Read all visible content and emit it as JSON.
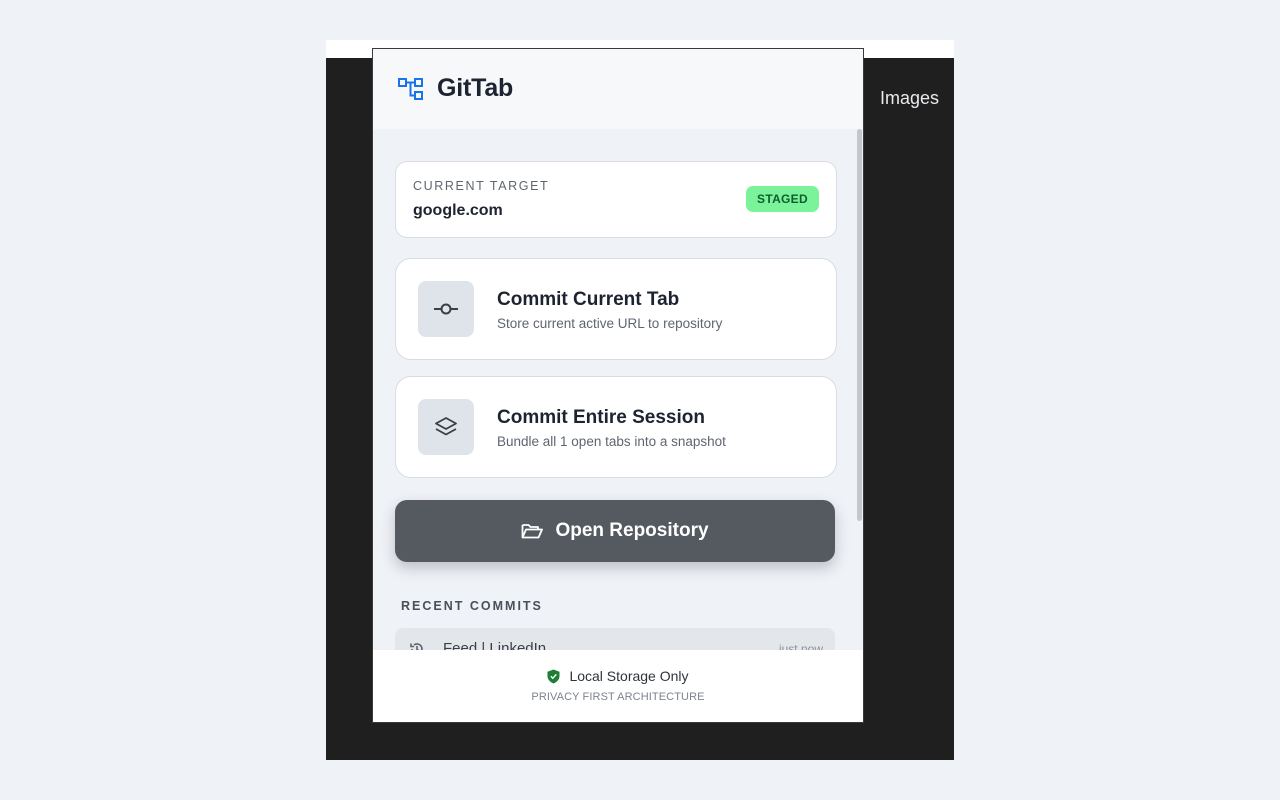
{
  "browser": {
    "images_link": "Images"
  },
  "popup": {
    "app_title": "GitTab",
    "target": {
      "label": "CURRENT TARGET",
      "value": "google.com",
      "status": "STAGED"
    },
    "actions": [
      {
        "title": "Commit Current Tab",
        "subtitle": "Store current active URL to repository",
        "icon": "git-commit-icon"
      },
      {
        "title": "Commit Entire Session",
        "subtitle": "Bundle all 1 open tabs into a snapshot",
        "icon": "layers-icon"
      }
    ],
    "open_repo_label": "Open Repository",
    "recent_heading": "RECENT COMMITS",
    "recent_commits": [
      {
        "title": "Feed | LinkedIn",
        "time": "just now"
      }
    ],
    "footer": {
      "main": "Local Storage Only",
      "sub": "PRIVACY FIRST ARCHITECTURE"
    }
  },
  "colors": {
    "badge_bg": "#7af39a",
    "badge_text": "#0f5e2c",
    "primary_button": "#555a61",
    "logo_blue": "#1a73e8",
    "shield_green": "#1e7e34"
  }
}
